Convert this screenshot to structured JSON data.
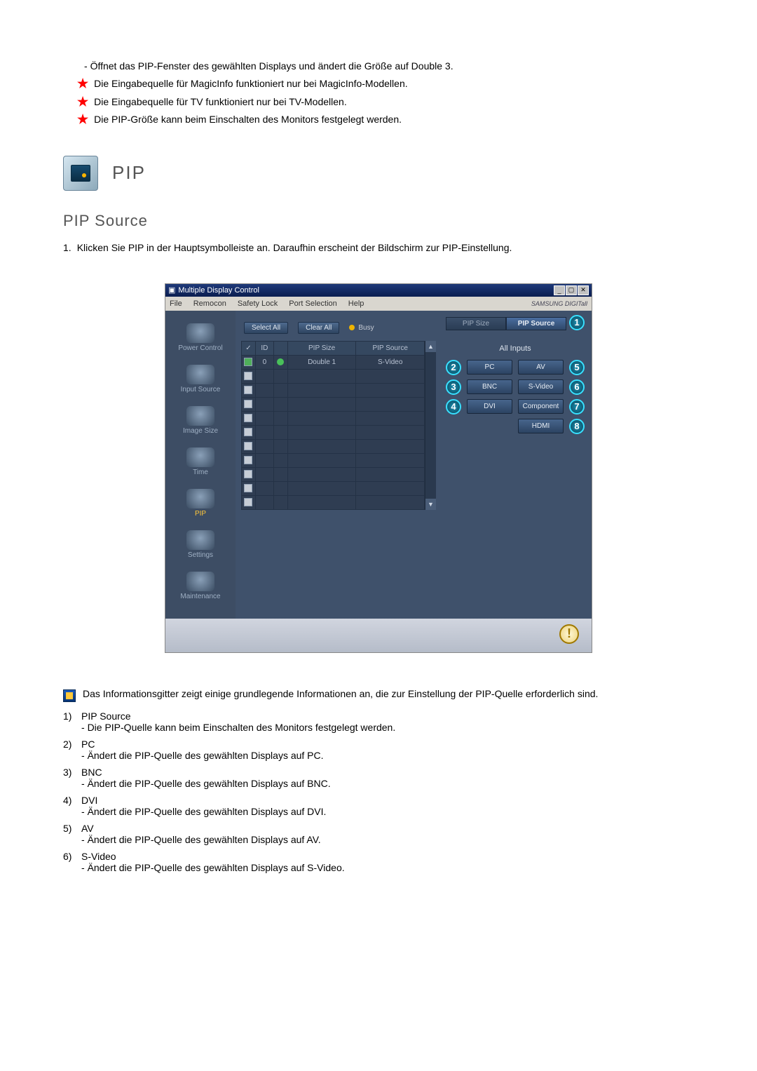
{
  "intro": {
    "dash1": "Öffnet das PIP-Fenster des gewählten Displays und ändert die Größe auf Double 3.",
    "star1": "Die Eingabequelle für MagicInfo funktioniert nur bei MagicInfo-Modellen.",
    "star2": "Die Eingabequelle für TV funktioniert nur bei TV-Modellen.",
    "star3": "Die PIP-Größe kann beim Einschalten des Monitors festgelegt werden."
  },
  "header": {
    "pip_title": "PIP"
  },
  "subheading": "PIP Source",
  "step1_num": "1.",
  "step1_text": "Klicken Sie PIP in der Hauptsymbolleiste an. Daraufhin erscheint der Bildschirm zur PIP-Einstellung.",
  "app": {
    "title": "Multiple Display Control",
    "brand": "SAMSUNG DIGITall",
    "menus": [
      "File",
      "Remocon",
      "Safety Lock",
      "Port Selection",
      "Help"
    ],
    "sidebar": [
      "Power Control",
      "Input Source",
      "Image Size",
      "Time",
      "PIP",
      "Settings",
      "Maintenance"
    ],
    "select_all": "Select All",
    "clear_all": "Clear All",
    "busy": "Busy",
    "grid_headers": {
      "chk": "✓",
      "id": "ID",
      "stat": "",
      "size": "PIP Size",
      "src": "PIP Source"
    },
    "grid_row": {
      "id": "0",
      "size": "Double 1",
      "src": "S-Video"
    },
    "tabs": {
      "size": "PIP Size",
      "source": "PIP Source"
    },
    "all_inputs": "All Inputs",
    "source_buttons": {
      "pc": "PC",
      "bnc": "BNC",
      "dvi": "DVI",
      "av": "AV",
      "svideo": "S-Video",
      "component": "Component",
      "hdmi": "HDMI"
    },
    "callouts": {
      "c1": "1",
      "c2": "2",
      "c3": "3",
      "c4": "4",
      "c5": "5",
      "c6": "6",
      "c7": "7",
      "c8": "8"
    }
  },
  "note": "Das Informationsgitter zeigt einige grundlegende Informationen an, die zur Einstellung der PIP-Quelle erforderlich sind.",
  "defs": [
    {
      "num": "1)",
      "title": "PIP Source",
      "sub": "Die PIP-Quelle kann beim Einschalten des Monitors festgelegt werden."
    },
    {
      "num": "2)",
      "title": "PC",
      "sub": "Ändert die PIP-Quelle des gewählten Displays auf PC."
    },
    {
      "num": "3)",
      "title": "BNC",
      "sub": "Ändert die PIP-Quelle des gewählten Displays auf BNC."
    },
    {
      "num": "4)",
      "title": "DVI",
      "sub": "Ändert die PIP-Quelle des gewählten Displays auf DVI."
    },
    {
      "num": "5)",
      "title": "AV",
      "sub": "Ändert die PIP-Quelle des gewählten Displays auf AV."
    },
    {
      "num": "6)",
      "title": "S-Video",
      "sub": "Ändert die PIP-Quelle des gewählten Displays auf S-Video."
    }
  ]
}
